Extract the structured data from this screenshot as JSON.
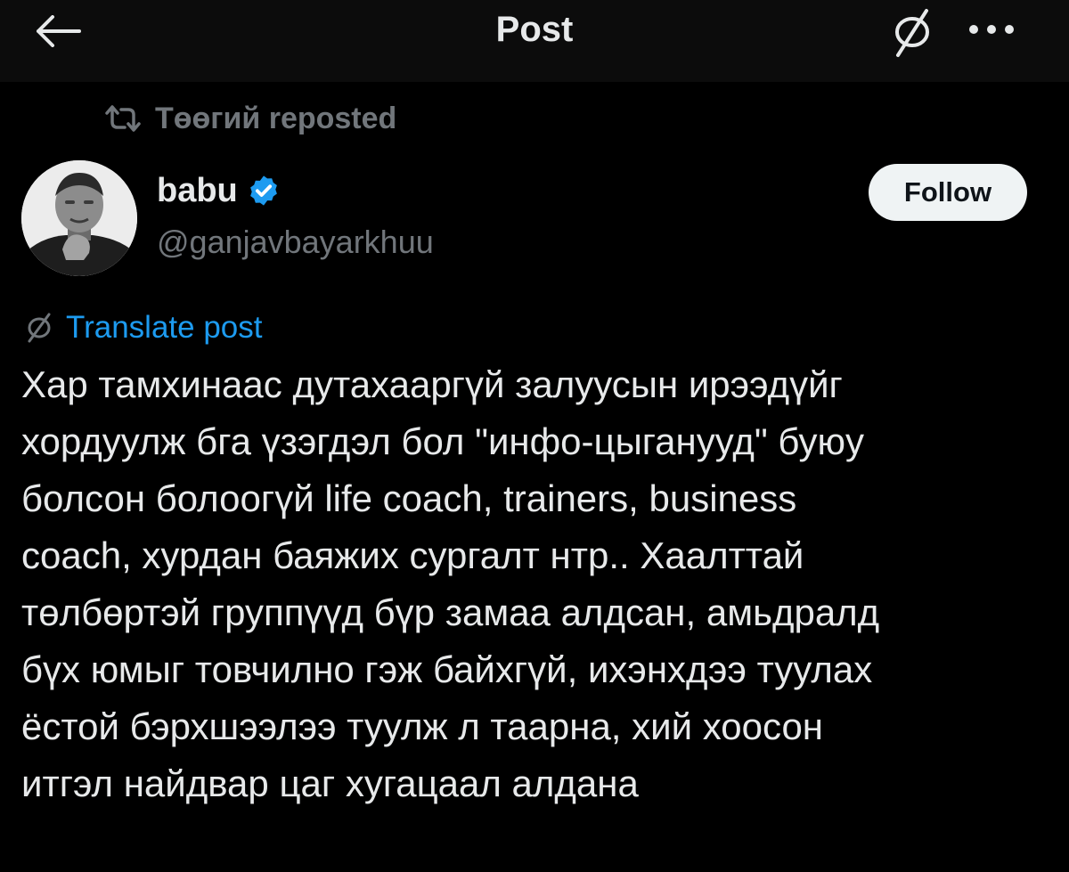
{
  "header": {
    "title": "Post",
    "back_icon": "arrow-left-icon",
    "translate_icon": "translate-icon",
    "more_icon": "more-horizontal-icon"
  },
  "repost": {
    "icon": "repost-icon",
    "text": "Төөгий reposted"
  },
  "author": {
    "display_name": "babu",
    "verified": true,
    "verified_icon": "verified-badge-icon",
    "handle": "@ganjavbayarkhuu",
    "avatar": "avatar-photo"
  },
  "follow_button": {
    "label": "Follow"
  },
  "translate": {
    "icon": "translate-icon",
    "label": "Translate post"
  },
  "post": {
    "lines": [
      "Хар тамхинаас дутахааргүй залуусын ирээдүйг",
      "хордуулж бга үзэгдэл бол \"инфо-цыганууд\" буюу",
      "болсон болоогүй life coach, trainers, business",
      "coach, хурдан баяжих сургалт нтр.. Хаалттай",
      "төлбөртэй группүүд бүр замаа алдсан, амьдралд",
      "бүх юмыг товчилно гэж байхгүй, ихэнхдээ туулах",
      "ёстой бэрхшээлээ туулж л таарна, хий хоосон",
      "итгэл найдвар цаг хугацаал алдана"
    ]
  },
  "colors": {
    "background": "#000000",
    "header_background": "#0c0c0c",
    "text_primary": "#e7e9ea",
    "text_secondary": "#71767b",
    "accent": "#1d9bf0",
    "follow_background": "#eff3f4"
  }
}
